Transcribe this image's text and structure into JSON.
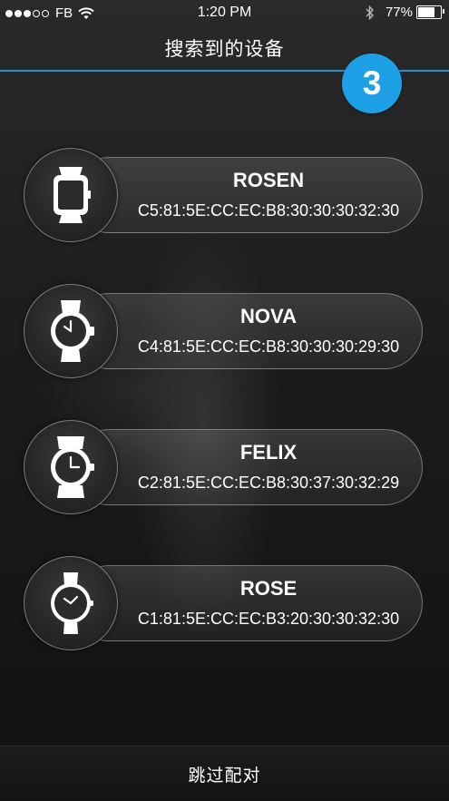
{
  "status_bar": {
    "carrier": "FB",
    "time": "1:20 PM",
    "battery_percent": "77%",
    "battery_level": 0.77,
    "signal_dots_filled": 3,
    "signal_dots_total": 5
  },
  "header": {
    "title": "搜索到的设备",
    "device_count": "3",
    "accent_color": "#1ea0e6"
  },
  "devices": [
    {
      "name": "ROSEN",
      "mac": "C5:81:5E:CC:EC:B8:30:30:30:32:30",
      "icon": "smartwatch-icon"
    },
    {
      "name": "NOVA",
      "mac": "C4:81:5E:CC:EC:B8:30:30:30:29:30",
      "icon": "analog-watch-icon"
    },
    {
      "name": "FELIX",
      "mac": "C2:81:5E:CC:EC:B8:30:37:30:32:29",
      "icon": "sport-watch-icon"
    },
    {
      "name": "ROSE",
      "mac": "C1:81:5E:CC:EC:B3:20:30:30:32:30",
      "icon": "round-watch-icon"
    }
  ],
  "footer": {
    "skip_label": "跳过配对"
  }
}
